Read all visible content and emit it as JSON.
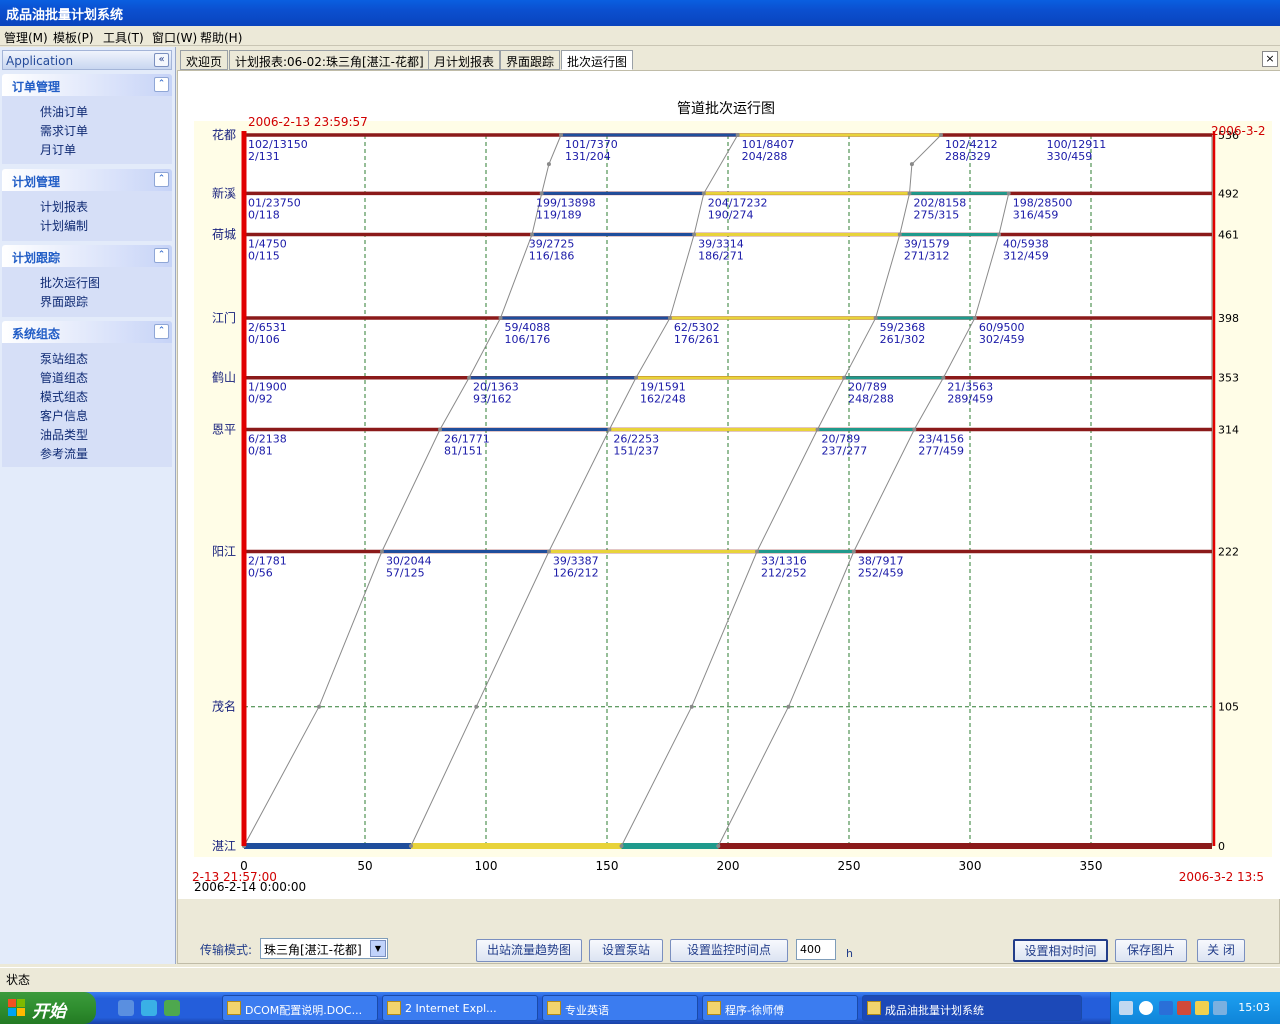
{
  "window": {
    "title": "成品油批量计划系统"
  },
  "menu": [
    "管理(M)",
    "模板(P)",
    "工具(T)",
    "窗口(W)",
    "帮助(H)"
  ],
  "sidebar": {
    "header": "Application",
    "groups": [
      {
        "title": "订单管理",
        "items": [
          "供油订单",
          "需求订单",
          "月订单"
        ]
      },
      {
        "title": "计划管理",
        "items": [
          "计划报表",
          "计划编制"
        ]
      },
      {
        "title": "计划跟踪",
        "items": [
          "批次运行图",
          "界面跟踪"
        ]
      },
      {
        "title": "系统组态",
        "items": [
          "泵站组态",
          "管道组态",
          "模式组态",
          "客户信息",
          "油品类型",
          "参考流量"
        ]
      }
    ]
  },
  "tabs": [
    "欢迎页",
    "计划报表:06-02:珠三角[湛江-花都]",
    "月计划报表",
    "界面跟踪",
    "批次运行图"
  ],
  "active_tab": 4,
  "chart_data": {
    "type": "line",
    "title": "管道批次运行图",
    "start_time_top": "2006-2-13 23:59:57",
    "end_time_top": "2006-3-2",
    "start_time_bottom": "2-13 21:57:00",
    "origin_time": "2006-2-14 0:00:00",
    "end_time_bottom": "2006-3-2 13:5",
    "xlim": [
      0,
      400
    ],
    "x_ticks": [
      0,
      50,
      100,
      150,
      200,
      250,
      300,
      350
    ],
    "ylim": [
      0,
      536
    ],
    "stations": [
      {
        "name": "花都",
        "mileage": 536
      },
      {
        "name": "新溪",
        "mileage": 492
      },
      {
        "name": "荷城",
        "mileage": 461
      },
      {
        "name": "江门",
        "mileage": 398
      },
      {
        "name": "鹤山",
        "mileage": 353
      },
      {
        "name": "恩平",
        "mileage": 314
      },
      {
        "name": "阳江",
        "mileage": 222
      },
      {
        "name": "茂名",
        "mileage": 105
      },
      {
        "name": "湛江",
        "mileage": 0
      }
    ],
    "batch_colors": [
      "#1f4e9c",
      "#e8d33a",
      "#1f9a8c",
      "#8b1a1a"
    ],
    "bottom_bar_breaks": [
      0,
      69,
      156,
      196,
      400
    ],
    "series": [
      {
        "points": [
          [
            0,
            0
          ],
          [
            31,
            105
          ],
          [
            57,
            222
          ],
          [
            81,
            314
          ],
          [
            93,
            353
          ],
          [
            106,
            398
          ],
          [
            119,
            461
          ],
          [
            123,
            492
          ],
          [
            126,
            514
          ],
          [
            131,
            536
          ]
        ]
      },
      {
        "points": [
          [
            69,
            0
          ],
          [
            96,
            105
          ],
          [
            126,
            222
          ],
          [
            151,
            314
          ],
          [
            162,
            353
          ],
          [
            176,
            398
          ],
          [
            186,
            461
          ],
          [
            190,
            492
          ],
          [
            204,
            536
          ]
        ]
      },
      {
        "points": [
          [
            156,
            0
          ],
          [
            185,
            105
          ],
          [
            212,
            222
          ],
          [
            237,
            314
          ],
          [
            248,
            353
          ],
          [
            261,
            398
          ],
          [
            271,
            461
          ],
          [
            275,
            492
          ],
          [
            276,
            514
          ],
          [
            288,
            536
          ]
        ]
      },
      {
        "points": [
          [
            196,
            0
          ],
          [
            225,
            105
          ],
          [
            252,
            222
          ],
          [
            277,
            314
          ],
          [
            289,
            353
          ],
          [
            302,
            398
          ],
          [
            312,
            461
          ],
          [
            316,
            492
          ]
        ]
      }
    ],
    "annotations": [
      {
        "x": 0,
        "m": 536,
        "l1": "102/13150",
        "l2": "2/131"
      },
      {
        "x": 131,
        "m": 536,
        "l1": "101/7370",
        "l2": "131/204"
      },
      {
        "x": 204,
        "m": 536,
        "l1": "101/8407",
        "l2": "204/288"
      },
      {
        "x": 288,
        "m": 536,
        "l1": "102/4212",
        "l2": "288/329"
      },
      {
        "x": 330,
        "m": 536,
        "l1": "100/12911",
        "l2": "330/459"
      },
      {
        "x": 0,
        "m": 492,
        "l1": "01/23750",
        "l2": "0/118"
      },
      {
        "x": 119,
        "m": 492,
        "l1": "199/13898",
        "l2": "119/189"
      },
      {
        "x": 190,
        "m": 492,
        "l1": "204/17232",
        "l2": "190/274"
      },
      {
        "x": 275,
        "m": 492,
        "l1": "202/8158",
        "l2": "275/315"
      },
      {
        "x": 316,
        "m": 492,
        "l1": "198/28500",
        "l2": "316/459"
      },
      {
        "x": 0,
        "m": 461,
        "l1": "1/4750",
        "l2": "0/115"
      },
      {
        "x": 116,
        "m": 461,
        "l1": "39/2725",
        "l2": "116/186"
      },
      {
        "x": 186,
        "m": 461,
        "l1": "39/3314",
        "l2": "186/271"
      },
      {
        "x": 271,
        "m": 461,
        "l1": "39/1579",
        "l2": "271/312"
      },
      {
        "x": 312,
        "m": 461,
        "l1": "40/5938",
        "l2": "312/459"
      },
      {
        "x": 0,
        "m": 398,
        "l1": "2/6531",
        "l2": "0/106"
      },
      {
        "x": 106,
        "m": 398,
        "l1": "59/4088",
        "l2": "106/176"
      },
      {
        "x": 176,
        "m": 398,
        "l1": "62/5302",
        "l2": "176/261"
      },
      {
        "x": 261,
        "m": 398,
        "l1": "59/2368",
        "l2": "261/302"
      },
      {
        "x": 302,
        "m": 398,
        "l1": "60/9500",
        "l2": "302/459"
      },
      {
        "x": 0,
        "m": 353,
        "l1": "1/1900",
        "l2": "0/92"
      },
      {
        "x": 93,
        "m": 353,
        "l1": "20/1363",
        "l2": "93/162"
      },
      {
        "x": 162,
        "m": 353,
        "l1": "19/1591",
        "l2": "162/248"
      },
      {
        "x": 248,
        "m": 353,
        "l1": "20/789",
        "l2": "248/288"
      },
      {
        "x": 289,
        "m": 353,
        "l1": "21/3563",
        "l2": "289/459"
      },
      {
        "x": 0,
        "m": 314,
        "l1": "6/2138",
        "l2": "0/81"
      },
      {
        "x": 81,
        "m": 314,
        "l1": "26/1771",
        "l2": "81/151"
      },
      {
        "x": 151,
        "m": 314,
        "l1": "26/2253",
        "l2": "151/237"
      },
      {
        "x": 237,
        "m": 314,
        "l1": "20/789",
        "l2": "237/277"
      },
      {
        "x": 277,
        "m": 314,
        "l1": "23/4156",
        "l2": "277/459"
      },
      {
        "x": 0,
        "m": 222,
        "l1": "2/1781",
        "l2": "0/56"
      },
      {
        "x": 57,
        "m": 222,
        "l1": "30/2044",
        "l2": "57/125"
      },
      {
        "x": 126,
        "m": 222,
        "l1": "39/3387",
        "l2": "126/212"
      },
      {
        "x": 212,
        "m": 222,
        "l1": "33/1316",
        "l2": "212/252"
      },
      {
        "x": 252,
        "m": 222,
        "l1": "38/7917",
        "l2": "252/459"
      }
    ]
  },
  "controls": {
    "mode_label": "传输模式:",
    "mode_value": "珠三角[湛江-花都]",
    "btn_outflow": "出站流量趋势图",
    "btn_pump": "设置泵站",
    "btn_monitor": "设置监控时间点",
    "hours_value": "400",
    "hours_unit": "h",
    "btn_relative": "设置相对时间",
    "btn_save": "保存图片",
    "btn_close": "关 闭"
  },
  "status": "状态",
  "taskbar": {
    "start": "开始",
    "tasks": [
      "DCOM配置说明.DOC...",
      "2 Internet Expl...",
      "专业英语",
      "程序-徐师傅",
      "成品油批量计划系统"
    ],
    "clock": "15:03"
  }
}
